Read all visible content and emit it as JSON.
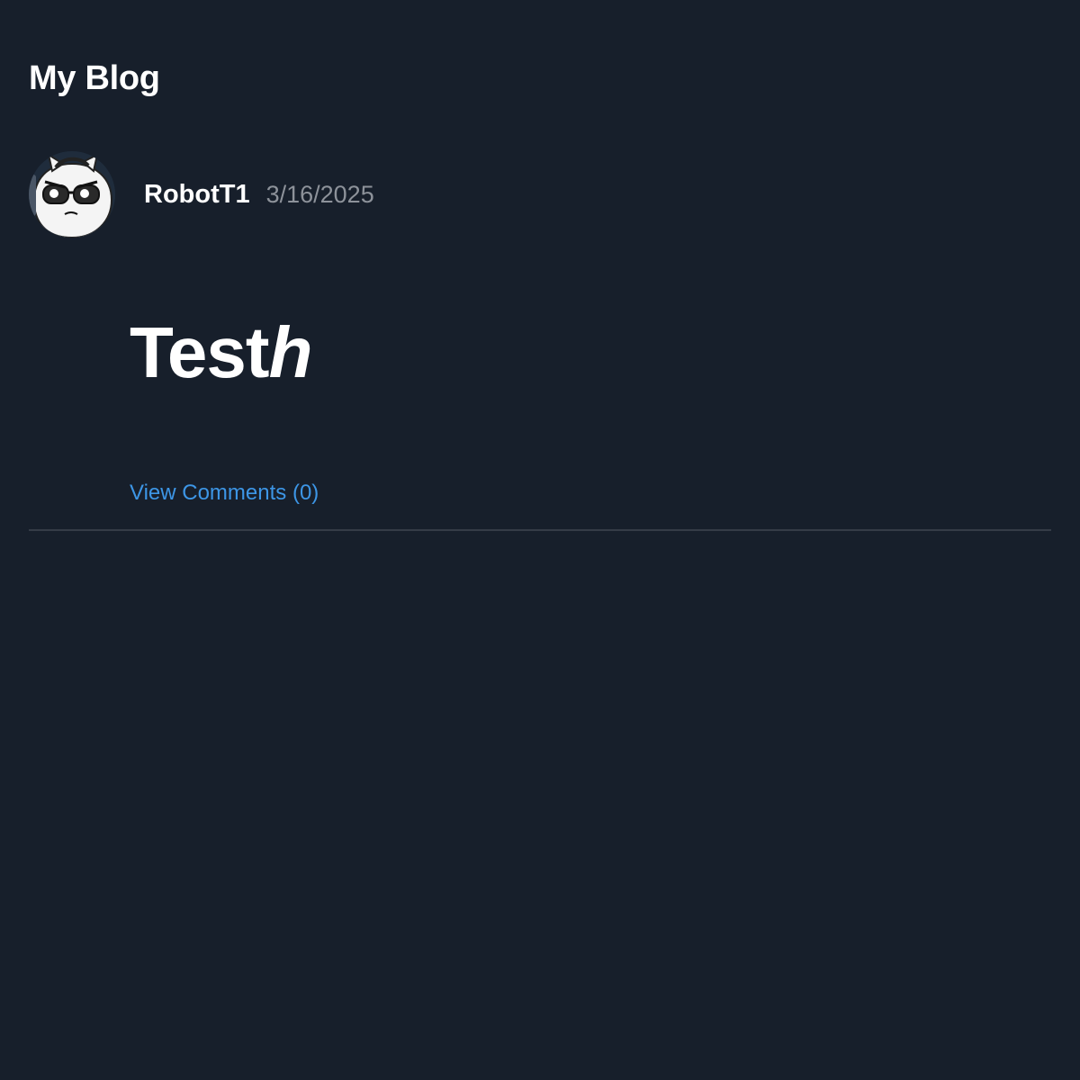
{
  "header": {
    "title": "My Blog"
  },
  "post": {
    "author": "RobotT1",
    "date": "3/16/2025",
    "content_regular": "Test",
    "content_italic": "h",
    "comments_link": "View Comments (0)",
    "avatar_icon": "robot-cat-avatar-icon"
  },
  "colors": {
    "background": "#171f2b",
    "text": "#ffffff",
    "muted": "#8d929a",
    "link": "#3d96e6",
    "divider": "#353c47"
  }
}
